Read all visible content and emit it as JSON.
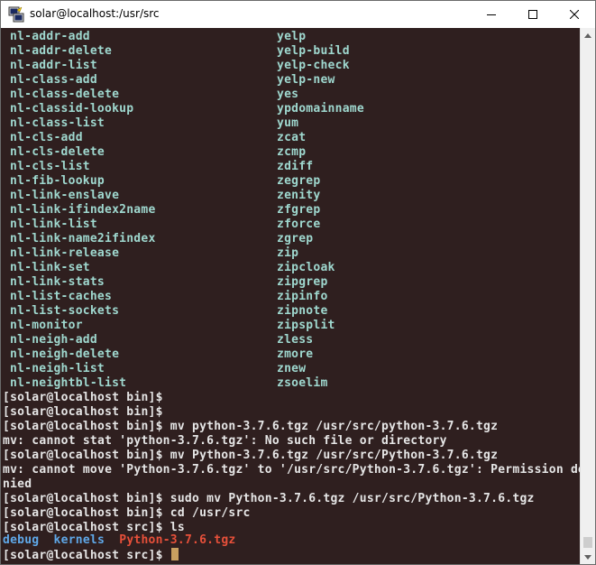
{
  "window": {
    "title": "solar@localhost:/usr/src",
    "icon": "putty-icon"
  },
  "colors": {
    "terminal_bg": "#2f1f1f",
    "listing_text": "#9fd8cf",
    "prompt_text": "#e6e6e6",
    "directory": "#5fa8e8",
    "archive": "#e8503a"
  },
  "listing": {
    "left": [
      "nl-addr-add",
      "nl-addr-delete",
      "nl-addr-list",
      "nl-class-add",
      "nl-class-delete",
      "nl-classid-lookup",
      "nl-class-list",
      "nl-cls-add",
      "nl-cls-delete",
      "nl-cls-list",
      "nl-fib-lookup",
      "nl-link-enslave",
      "nl-link-ifindex2name",
      "nl-link-list",
      "nl-link-name2ifindex",
      "nl-link-release",
      "nl-link-set",
      "nl-link-stats",
      "nl-list-caches",
      "nl-list-sockets",
      "nl-monitor",
      "nl-neigh-add",
      "nl-neigh-delete",
      "nl-neigh-list",
      "nl-neightbl-list"
    ],
    "right": [
      "yelp",
      "yelp-build",
      "yelp-check",
      "yelp-new",
      "yes",
      "ypdomainname",
      "yum",
      "zcat",
      "zcmp",
      "zdiff",
      "zegrep",
      "zenity",
      "zfgrep",
      "zforce",
      "zgrep",
      "zip",
      "zipcloak",
      "zipgrep",
      "zipinfo",
      "zipnote",
      "zipsplit",
      "zless",
      "zmore",
      "znew",
      "zsoelim"
    ]
  },
  "session": [
    "[solar@localhost bin]$",
    "[solar@localhost bin]$",
    "[solar@localhost bin]$ mv python-3.7.6.tgz /usr/src/python-3.7.6.tgz",
    "mv: cannot stat 'python-3.7.6.tgz': No such file or directory",
    "[solar@localhost bin]$ mv Python-3.7.6.tgz /usr/src/Python-3.7.6.tgz",
    "mv: cannot move 'Python-3.7.6.tgz' to '/usr/src/Python-3.7.6.tgz': Permission de",
    "nied",
    "[solar@localhost bin]$ sudo mv Python-3.7.6.tgz /usr/src/Python-3.7.6.tgz",
    "[solar@localhost bin]$ cd /usr/src",
    "[solar@localhost src]$ ls"
  ],
  "ls_output": {
    "debug": "debug",
    "kernels": "kernels",
    "archive": "Python-3.7.6.tgz"
  },
  "final_prompt": "[solar@localhost src]$ "
}
